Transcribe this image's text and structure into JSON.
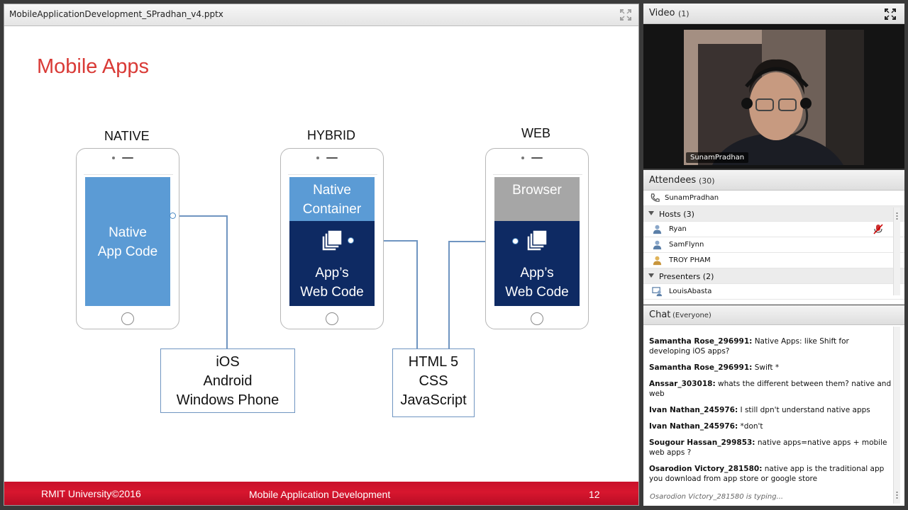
{
  "slide_pane": {
    "filename": "MobileApplicationDevelopment_SPradhan_v4.pptx"
  },
  "slide": {
    "title": "Mobile Apps",
    "columns": {
      "native": {
        "label": "NATIVE",
        "screen_line1": "Native",
        "screen_line2": "App Code",
        "box": [
          "iOS",
          "Android",
          "Windows Phone"
        ]
      },
      "hybrid": {
        "label": "HYBRID",
        "container_line1": "Native",
        "container_line2": "Container",
        "code_line1": "App’s",
        "code_line2": "Web Code"
      },
      "web": {
        "label": "WEB",
        "browser": "Browser",
        "code_line1": "App’s",
        "code_line2": "Web Code"
      },
      "shared_box": [
        "HTML 5",
        "CSS",
        "JavaScript"
      ]
    },
    "footer": {
      "left": "RMIT University©2016",
      "center": "Mobile Application Development",
      "page": "12"
    },
    "colors": {
      "title": "#d93a36",
      "native_blue": "#5b9bd5",
      "dark_navy": "#0e2a63",
      "browser_gray": "#a6a6a6",
      "footer_red": "#c9102a"
    }
  },
  "video": {
    "title": "Video",
    "count": "(1)",
    "presenter_name": "SunamPradhan"
  },
  "attendees": {
    "title": "Attendees",
    "count": "(30)",
    "caller": "SunamPradhan",
    "hosts_label": "Hosts (3)",
    "hosts": [
      "Ryan",
      "SamFlynn",
      "TROY PHAM"
    ],
    "presenters_label": "Presenters (2)",
    "presenters": [
      "LouisAbasta"
    ]
  },
  "chat": {
    "title": "Chat",
    "scope": "(Everyone)",
    "messages": [
      {
        "sender": "Samantha Rose_296991:",
        "text": "Native Apps: like Shift for developing iOS apps?"
      },
      {
        "sender": "Samantha Rose_296991:",
        "text": "Swift *"
      },
      {
        "sender": "Anssar_303018:",
        "text": "whats the different between them? native and web"
      },
      {
        "sender": "Ivan Nathan_245976:",
        "text": "I still dpn't understand native apps"
      },
      {
        "sender": "Ivan Nathan_245976:",
        "text": "*don't"
      },
      {
        "sender": "Sougour Hassan_299853:",
        "text": "native apps=native apps + mobile web apps ?"
      },
      {
        "sender": "Osarodion Victory_281580:",
        "text": "native app is the traditional app you download from app store or google store"
      }
    ],
    "typing": "Osarodion Victory_281580 is typing..."
  }
}
